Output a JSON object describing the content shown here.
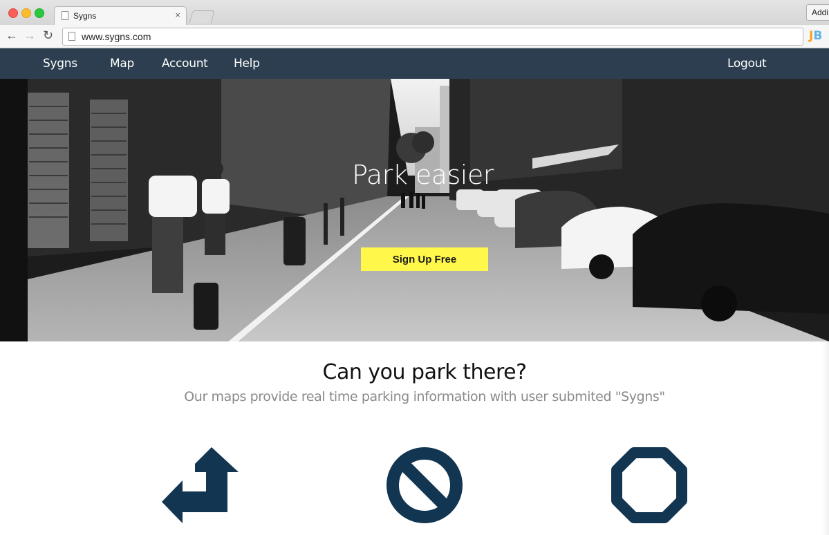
{
  "browser": {
    "tab_title": "Sygns",
    "tab_close": "×",
    "url": "www.sygns.com",
    "right_tab_label": "Addi",
    "extension_label_j": "J",
    "extension_label_b": "B"
  },
  "nav": {
    "brand": "Sygns",
    "items": [
      {
        "label": "Map"
      },
      {
        "label": "Account"
      },
      {
        "label": "Help"
      }
    ],
    "logout": "Logout"
  },
  "hero": {
    "title": "Park easier",
    "cta": "Sign Up Free",
    "image": "black-and-white-street-photo-icon"
  },
  "intro": {
    "heading": "Can you park there?",
    "subheading": "Our maps provide real time parking information with user submited \"Sygns\""
  },
  "features": [
    {
      "icon": "turn-arrow-icon"
    },
    {
      "icon": "no-entry-icon"
    },
    {
      "icon": "stop-octagon-icon"
    }
  ],
  "colors": {
    "nav_bg": "#2c3e50",
    "cta_bg": "#fff84a",
    "icon_color": "#123652",
    "subheading": "#8a8a8a"
  }
}
